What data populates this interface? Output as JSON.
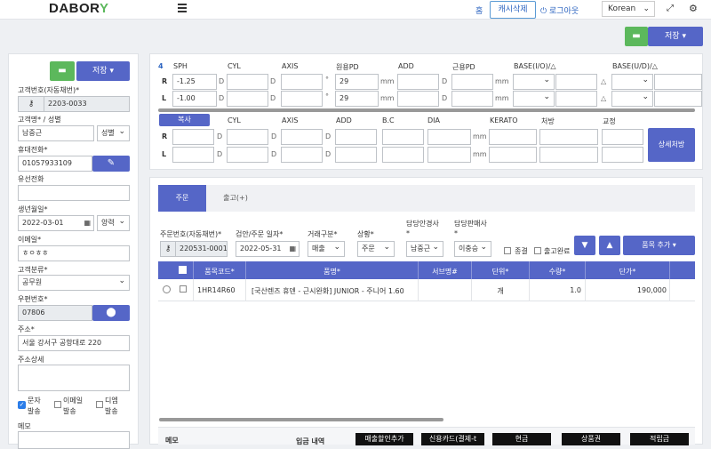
{
  "header": {
    "logo_text": "DABOR",
    "logo_leaf": "Y",
    "home_label": "홈",
    "cache_label": "캐시삭제",
    "logout_label": "로그아웃",
    "language": "Korean"
  },
  "top_actions": {
    "save_label": "저장"
  },
  "customer": {
    "save_label": "저장",
    "customer_no_label": "고객번호(자동채번)*",
    "customer_no_value": "2203-0033",
    "name_label": "고객명* / 성별",
    "name_value": "남중근",
    "gender_value": "성별",
    "mobile_label": "휴대전화*",
    "mobile_value": "01057933109",
    "landline_label": "유선전화",
    "landline_value": "",
    "birth_label": "생년월일*",
    "birth_value": "2022-03-01",
    "calendar_value": "양력",
    "email_label": "이메일*",
    "email_value": "ㅎㅇㅎㅎ",
    "category_label": "고객분류*",
    "category_value": "공무원",
    "zip_label": "우편번호*",
    "zip_value": "07806",
    "address_label": "주소*",
    "address_value": "서울 강서구 공항대로 220",
    "address_detail_label": "주소상세",
    "address_detail_value": "",
    "sms_label_1": "문자",
    "sms_label_2": "발송",
    "email_send_label_1": "이메일",
    "email_send_label_2": "발송",
    "dm_label_1": "디엠",
    "dm_label_2": "발송",
    "memo_label": "메모"
  },
  "prescription": {
    "number": "4",
    "headers": [
      "SPH",
      "CYL",
      "AXIS",
      "원용PD",
      "ADD",
      "근용PD",
      "BASE(I/O)/△",
      "BASE(U/D)/△"
    ],
    "row_r_label": "R",
    "row_l_label": "L",
    "r_sph": "-1.25",
    "l_sph": "-1.00",
    "r_pd": "29",
    "l_pd": "29",
    "unit_d": "D",
    "unit_deg": "°",
    "unit_mm": "mm",
    "unit_tri": "△"
  },
  "contact": {
    "copy_label": "복사",
    "headers": [
      "CYL",
      "AXIS",
      "ADD",
      "B.C",
      "DIA",
      "KERATO",
      "처방",
      "교정"
    ],
    "row_r_label": "R",
    "row_l_label": "L",
    "unit_d": "D",
    "unit_mm": "mm",
    "detail_button": "상세처방"
  },
  "order": {
    "tab_order": "주문",
    "tab_release": "출고(+)",
    "order_no_label": "주문번호(자동채번)*",
    "order_no_value": "220531-0001",
    "date_label": "검안/주문 일자*",
    "date_value": "2022-05-31",
    "trade_label": "거래구분*",
    "trade_value": "매출",
    "status_label": "상황*",
    "status_value": "주문",
    "optician_label": "담당안경사",
    "optician_star": "*",
    "optician_value": "남중근",
    "seller_label": "담당판매사",
    "seller_star": "*",
    "seller_value": "이충승",
    "close_label": "종결",
    "release_done_label": "출고완료",
    "add_item_label": "품목 추가",
    "table_headers": [
      "품목코드*",
      "품명*",
      "서브명#",
      "단위*",
      "수량*",
      "단가*"
    ],
    "rows": [
      {
        "code": "1HR14R60",
        "name": "[국산렌즈 휴덴 - 근시완화] JUNIOR - 주니어 1.60",
        "sub": "",
        "unit": "개",
        "qty": "1.0",
        "price": "190,000"
      }
    ]
  },
  "bottom": {
    "memo_label": "메모",
    "payment_label": "입금 내역",
    "buttons": [
      "매출할인추가",
      "신용카드(결제-t",
      "현금",
      "상품권",
      "적립금"
    ]
  }
}
